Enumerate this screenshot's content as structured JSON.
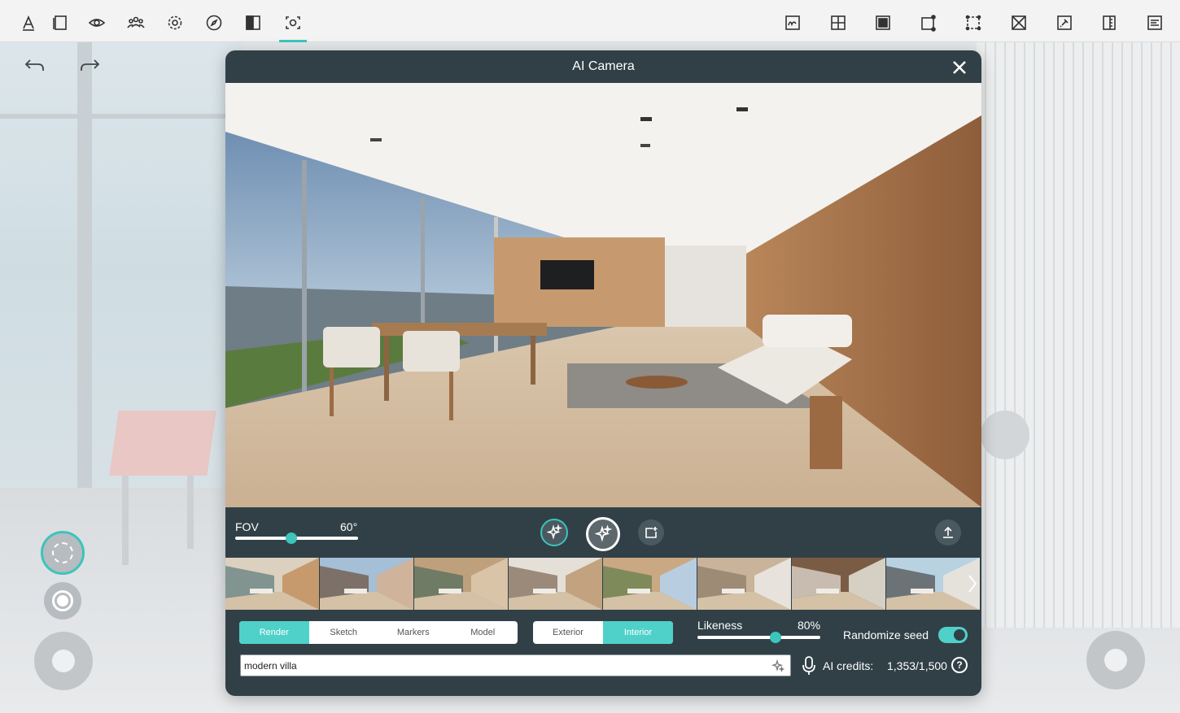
{
  "dialog": {
    "title": "AI Camera",
    "fov": {
      "label": "FOV",
      "value_text": "60°",
      "value": 60
    },
    "likeness": {
      "label": "Likeness",
      "value_text": "80%",
      "value": 80
    },
    "render_modes": [
      {
        "label": "Render",
        "selected": true
      },
      {
        "label": "Sketch",
        "selected": false
      },
      {
        "label": "Markers",
        "selected": false
      },
      {
        "label": "Model",
        "selected": false
      }
    ],
    "scene_types": [
      {
        "label": "Exterior",
        "selected": false
      },
      {
        "label": "Interior",
        "selected": true
      }
    ],
    "randomize_seed": {
      "label": "Randomize seed",
      "on": true
    },
    "prompt": {
      "value": "modern villa"
    },
    "credits": {
      "label": "AI credits:",
      "value": "1,353/1,500"
    },
    "help": "?"
  },
  "toolbar_icons_left": [
    "text-style-icon",
    "layers-icon",
    "eye-icon",
    "people-icon",
    "settings-icon",
    "compass-icon",
    "split-view-icon",
    "ai-camera-icon"
  ],
  "toolbar_icons_right": [
    "signature-icon",
    "add-square-icon",
    "fill-square-icon",
    "node-square-icon",
    "dashed-select-icon",
    "cross-square-icon",
    "pin-icon",
    "ruler-icon",
    "notes-icon"
  ],
  "colors": {
    "accent": "#3cc4bd",
    "dialog_bg": "#314047"
  }
}
